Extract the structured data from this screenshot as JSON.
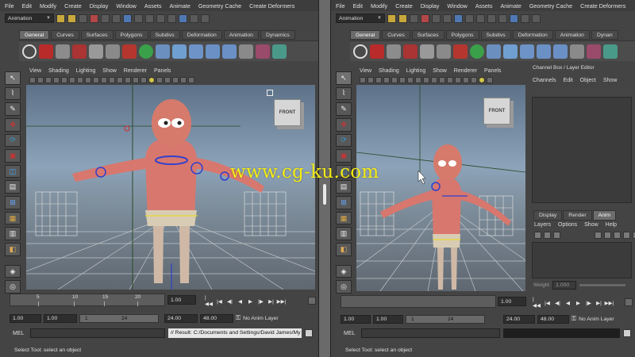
{
  "left": {
    "menu": [
      "File",
      "Edit",
      "Modify",
      "Create",
      "Display",
      "Window",
      "Assets",
      "Animate",
      "Geometry Cache",
      "Create Deformers"
    ],
    "mode": "Animation",
    "shelf_tabs": [
      "General",
      "Curves",
      "Surfaces",
      "Polygons",
      "Subdivs",
      "Deformation",
      "Animation",
      "Dynamics"
    ],
    "viewport_menu": [
      "View",
      "Shading",
      "Lighting",
      "Show",
      "Renderer",
      "Panels"
    ],
    "viewcube_label": "FRONT",
    "timeline_numbers": [
      "5",
      "10",
      "15",
      "20"
    ],
    "current_frame": "1.00",
    "range": {
      "start": "1.00",
      "start2": "1.00",
      "bar_left": "1",
      "bar_right": "24",
      "end": "24.00",
      "end2": "48.00"
    },
    "anim_layer": "No Anim Layer",
    "mel_label": "MEL",
    "result_text": "// Result: C:/Documents and Settings/David James/My I",
    "help_line": "Select Tool: select an object"
  },
  "right": {
    "menu": [
      "File",
      "Edit",
      "Modify",
      "Create",
      "Display",
      "Window",
      "Assets",
      "Animate",
      "Geometry Cache",
      "Create Deformers"
    ],
    "mode": "Animation",
    "shelf_tabs": [
      "General",
      "Curves",
      "Surfaces",
      "Polygons",
      "Subdivs",
      "Deformation",
      "Animation",
      "Dynan"
    ],
    "viewport_menu": [
      "View",
      "Shading",
      "Lighting",
      "Show",
      "Renderer",
      "Panels"
    ],
    "viewcube_label": "FRONT",
    "channel_box": {
      "title": "Channel Box / Layer Editor",
      "menu": [
        "Channels",
        "Edit",
        "Object",
        "Show"
      ]
    },
    "layer_tabs": [
      "Display",
      "Render",
      "Anim"
    ],
    "layer_menu": [
      "Layers",
      "Options",
      "Show",
      "Help"
    ],
    "weight_label": "Weight",
    "weight_value": "1.000",
    "current_frame": "1.00",
    "range": {
      "start": "1.00",
      "start2": "1.00",
      "bar_left": "1",
      "bar_right": "24",
      "end": "24.00",
      "end2": "48.00"
    },
    "anim_layer": "No Anim Layer",
    "mel_label": "MEL",
    "help_line": "Select Tool: select an object"
  },
  "watermark": "www.cg-ku.com",
  "playback_glyphs": [
    "|◀◀",
    "|◀",
    "◀|",
    "◀",
    "▶",
    "|▶",
    "▶|",
    "▶▶|"
  ]
}
